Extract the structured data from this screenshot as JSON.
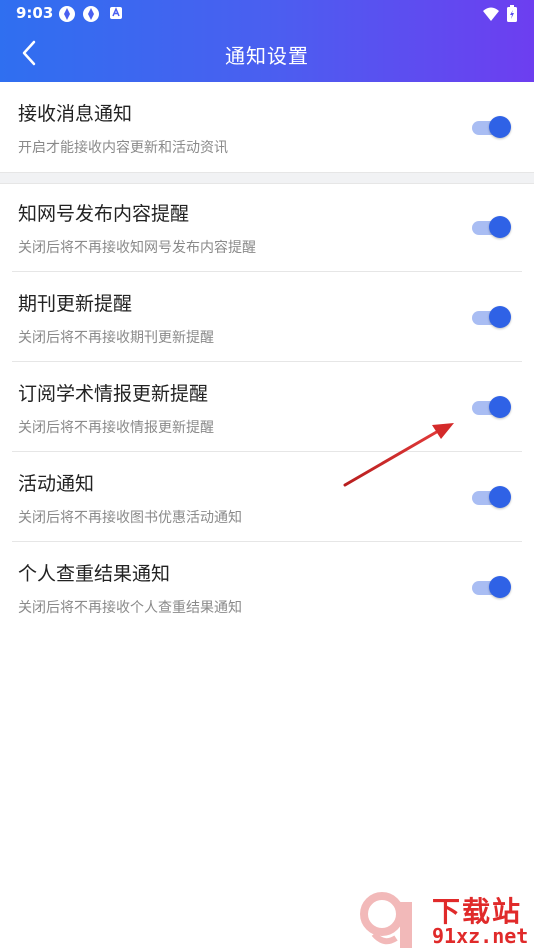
{
  "status_bar": {
    "time": "9:03",
    "icons": [
      "app-icon",
      "app-icon",
      "notification-icon"
    ],
    "right_icons": [
      "wifi-icon",
      "battery-icon"
    ]
  },
  "header": {
    "title": "通知设置",
    "back_icon": "chevron-left-icon"
  },
  "settings": [
    {
      "title": "接收消息通知",
      "subtitle": "开启才能接收内容更新和活动资讯",
      "enabled": true
    },
    {
      "title": "知网号发布内容提醒",
      "subtitle": "关闭后将不再接收知网号发布内容提醒",
      "enabled": true
    },
    {
      "title": "期刊更新提醒",
      "subtitle": "关闭后将不再接收期刊更新提醒",
      "enabled": true
    },
    {
      "title": "订阅学术情报更新提醒",
      "subtitle": "关闭后将不再接收情报更新提醒",
      "enabled": true
    },
    {
      "title": "活动通知",
      "subtitle": "关闭后将不再接收图书优惠活动通知",
      "enabled": true
    },
    {
      "title": "个人查重结果通知",
      "subtitle": "关闭后将不再接收个人查重结果通知",
      "enabled": true
    }
  ],
  "watermark": {
    "title": "下载站",
    "url": "91xz.net"
  },
  "colors": {
    "header_start": "#2f6ff0",
    "header_end": "#6d3ef0",
    "toggle_on": "#2f62e6",
    "annotation_arrow": "#d42a2a"
  }
}
